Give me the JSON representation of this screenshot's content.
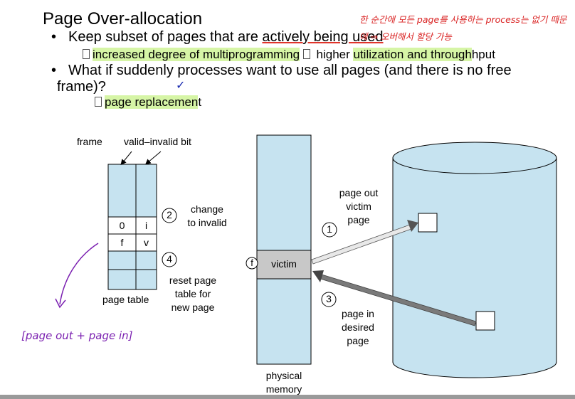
{
  "slide": {
    "title": "Page Over-allocation",
    "bullet1": {
      "pre": "Keep subset of pages that are ",
      "underlined": "actively being used",
      "sub_part1": "increased degree of multiprogramming",
      "sub_part2_pre": " higher ",
      "sub_part2_hl": "utilization and through",
      "sub_part2_post": "hput"
    },
    "bullet2": {
      "line1": "What if suddenly processes want to use all pages (and there is no free",
      "line2": "frame)?",
      "sub_hl": "page replacemen",
      "sub_post": "t"
    }
  },
  "annotations": {
    "red_note": "한 순간에 모든 page를 사용하는 process는  없기 때문에 ⇒ 오버해서 할당 가능",
    "check_mark": "✓",
    "purple_note": "[page out  +  page in]"
  },
  "figure": {
    "frame_label": "frame",
    "valid_bit_label": "valid–invalid bit",
    "page_table_label": "page table",
    "rows": [
      {
        "frame": "0",
        "bit": "i"
      },
      {
        "frame": "f",
        "bit": "v"
      }
    ],
    "step1": "1",
    "step2": "2",
    "step3": "3",
    "step4": "4",
    "change_line1": "change",
    "change_line2": "to invalid",
    "reset_line1": "reset page",
    "reset_line2": "table for",
    "reset_line3": "new page",
    "victim_label": "victim",
    "f_marker": "f",
    "physical_line1": "physical",
    "physical_line2": "memory",
    "pageout_line1": "page out",
    "pageout_line2": "victim",
    "pageout_line3": "page",
    "pagein_line1": "page in",
    "pagein_line2": "desired",
    "pagein_line3": "page"
  }
}
